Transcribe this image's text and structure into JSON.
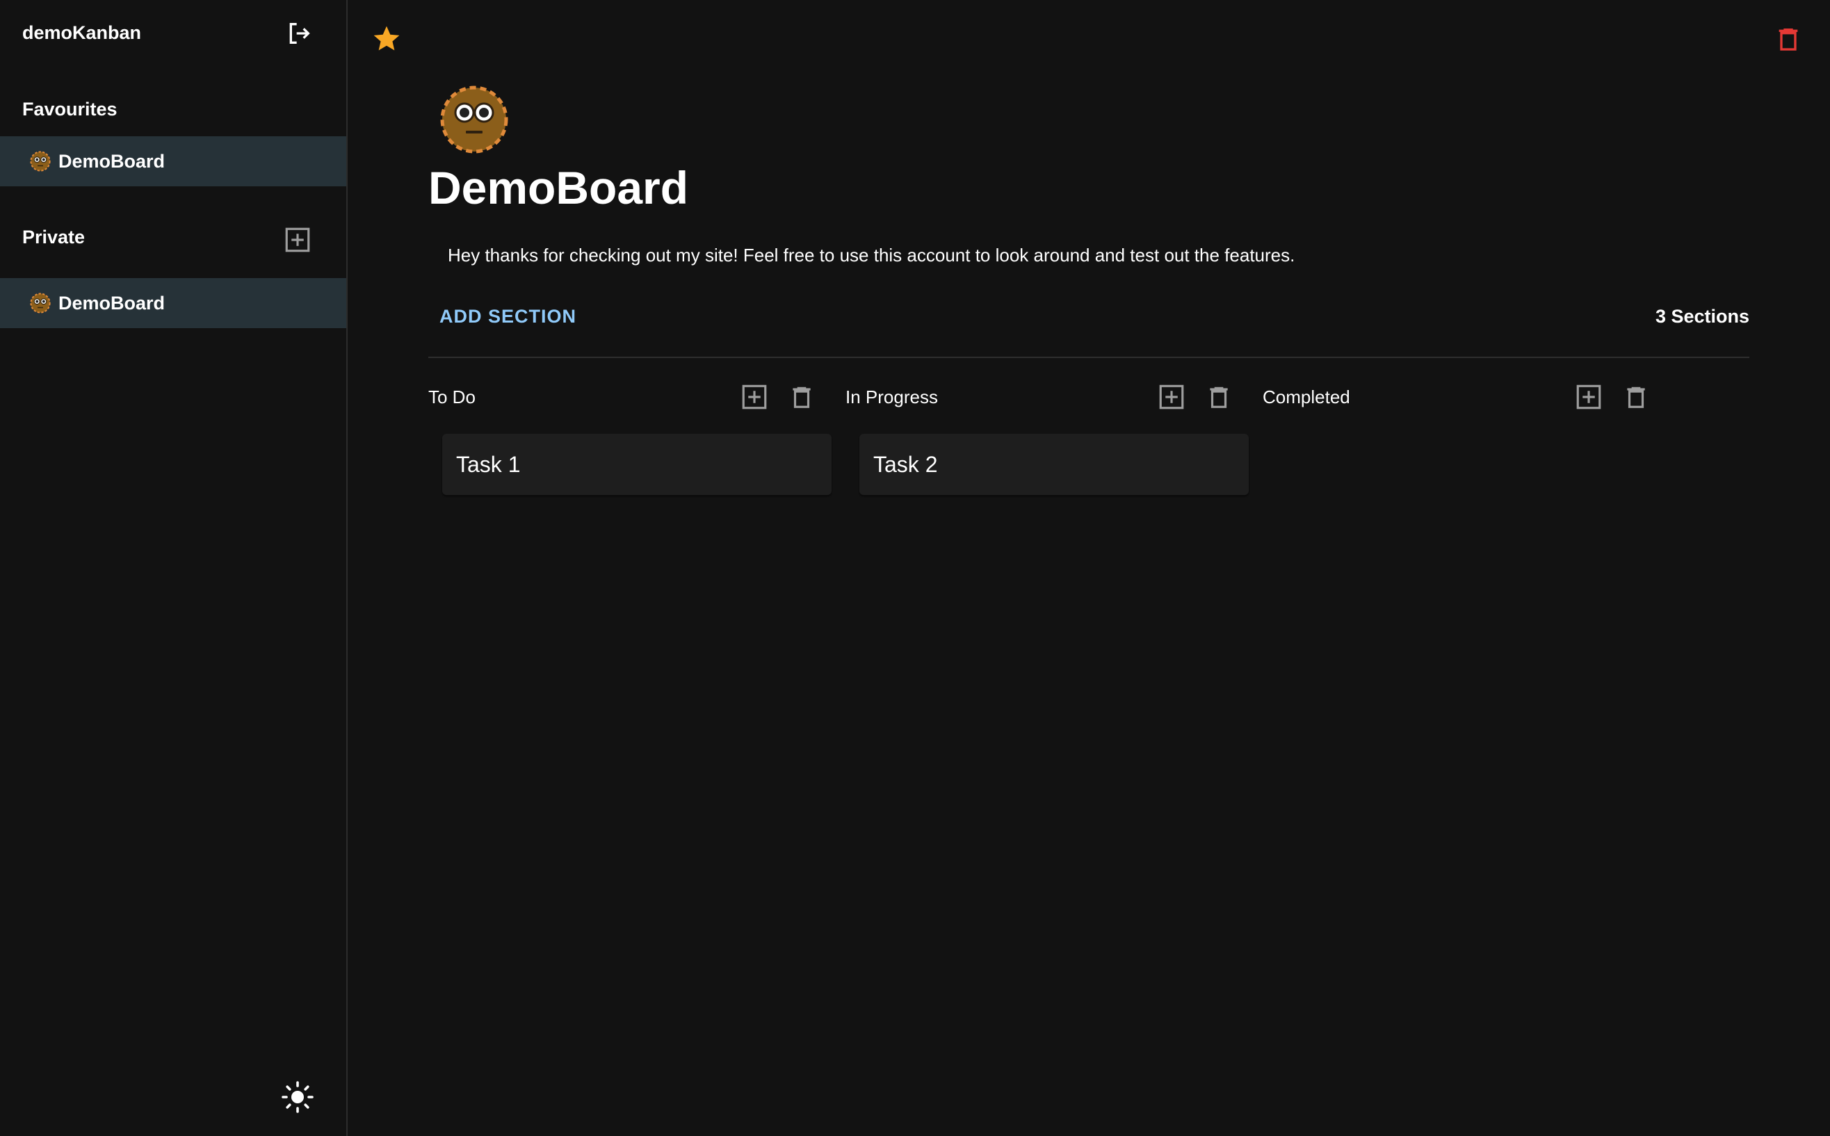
{
  "sidebar": {
    "app_title": "demoKanban",
    "favourites_label": "Favourites",
    "private_label": "Private",
    "favourites": [
      {
        "label": "DemoBoard",
        "icon": "face-emoji-icon"
      }
    ],
    "private": [
      {
        "label": "DemoBoard",
        "icon": "face-emoji-icon"
      }
    ]
  },
  "board": {
    "title": "DemoBoard",
    "description": "Hey thanks for checking out my site! Feel free to use this account to look around and test out the features.",
    "add_section_label": "ADD SECTION",
    "section_count": "3 Sections",
    "favourited": true,
    "sections": [
      {
        "title": "To Do",
        "tasks": [
          "Task 1"
        ]
      },
      {
        "title": "In Progress",
        "tasks": [
          "Task 2"
        ]
      },
      {
        "title": "Completed",
        "tasks": []
      }
    ]
  },
  "colors": {
    "background": "#121212",
    "sidebar_selected": "#263238",
    "accent_link": "#90caf9",
    "star": "#f9a825",
    "delete": "#e53935",
    "card": "#1e1e1e",
    "icon_grey": "#9e9e9e"
  }
}
